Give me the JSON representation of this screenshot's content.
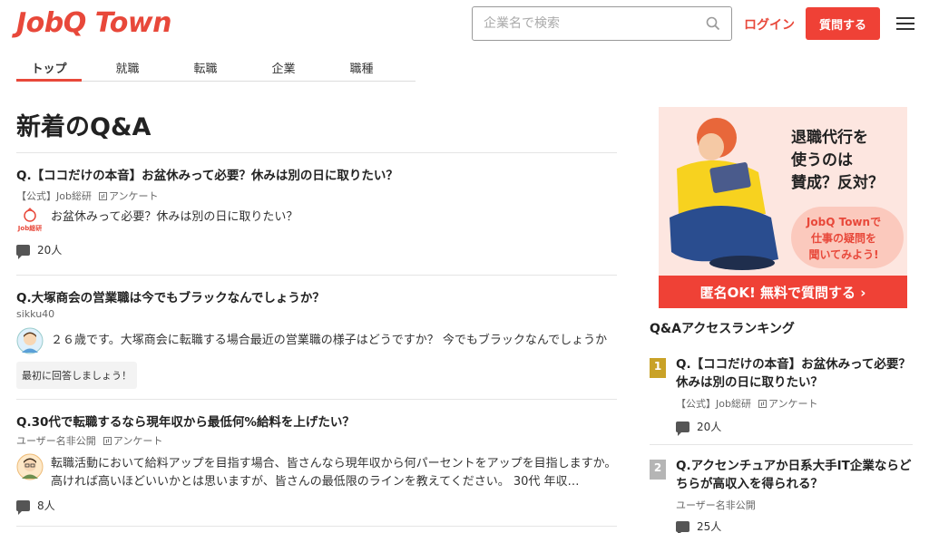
{
  "header": {
    "logo": "JobQ Town",
    "search_placeholder": "企業名で検索",
    "login": "ログイン",
    "ask_button": "質問する"
  },
  "nav": {
    "tabs": [
      {
        "label": "トップ",
        "active": true
      },
      {
        "label": "就職",
        "active": false
      },
      {
        "label": "転職",
        "active": false
      },
      {
        "label": "企業",
        "active": false
      },
      {
        "label": "職種",
        "active": false
      }
    ]
  },
  "main": {
    "title": "新着のQ&A",
    "questions": [
      {
        "title": "Q.【ココだけの本音】お盆休みって必要？休みは別の日に取りたい？",
        "author": "【公式】Job総研",
        "tag": "アンケート",
        "body": "お盆休みって必要？休みは別の日に取りたい？",
        "answers": "20人"
      },
      {
        "title": "Q.大塚商会の営業職は今でもブラックなんでしょうか？",
        "author": "sikku40",
        "body": "２６歳です。大塚商会に転職する場合最近の営業職の様子はどうですか？ 今でもブラックなんでしょうか",
        "cta": "最初に回答しましょう！"
      },
      {
        "title": "Q.30代で転職するなら現年収から最低何%給料を上げたい？",
        "author": "ユーザー名非公開",
        "tag": "アンケート",
        "body_line1": "転職活動において給料アップを目指す場合、皆さんなら現年収から何パーセントをアップを目指しますか。",
        "body_line2": "高ければ高いほどいいかとは思いますが、皆さんの最低限のラインを教えてください。 30代 年収…",
        "answers": "8人"
      }
    ]
  },
  "sidebar": {
    "banner": {
      "line1": "退職代行を",
      "line2": "使うのは",
      "line3": "賛成？反対？",
      "sub1": "JobQ Townで",
      "sub2": "仕事の疑問を",
      "sub3": "聞いてみよう!",
      "cta": "匿名OK! 無料で質問する ›"
    },
    "ranking_title": "Q&Aアクセスランキング",
    "ranking": [
      {
        "rank": "1",
        "title": "Q.【ココだけの本音】お盆休みって必要？休みは別の日に取りたい？",
        "author": "【公式】Job総研",
        "tag": "アンケート",
        "answers": "20人"
      },
      {
        "rank": "2",
        "title": "Q.アクセンチュアか日系大手IT企業ならどちらが高収入を得られる？",
        "author": "ユーザー名非公開",
        "answers": "25人"
      }
    ]
  },
  "colors": {
    "brand": "#e8483a",
    "button": "#ef4136",
    "rank1": "#c9a227",
    "rank2": "#b5b5b5"
  }
}
